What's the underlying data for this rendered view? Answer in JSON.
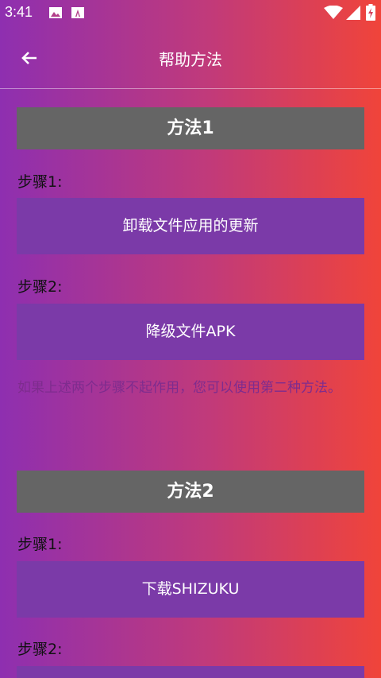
{
  "status_bar": {
    "time": "3:41"
  },
  "app_bar": {
    "title": "帮助方法"
  },
  "method1": {
    "title": "方法1",
    "step1_label": "步骤1:",
    "step1_button": "卸载文件应用的更新",
    "step2_label": "步骤2:",
    "step2_button": "降级文件APK",
    "note": "如果上述两个步骤不起作用，您可以使用第二种方法。"
  },
  "method2": {
    "title": "方法2",
    "step1_label": "步骤1:",
    "step1_button": "下载SHIZUKU",
    "step2_label": "步骤2:"
  },
  "colors": {
    "gradient_start": "#8e2fb0",
    "gradient_end": "#f0443a",
    "section_header_bg": "#656565",
    "action_button_bg": "#7b3aa8"
  },
  "icons": [
    "image-icon",
    "text-app-icon",
    "wifi-icon",
    "signal-icon",
    "battery-icon",
    "back-arrow-icon"
  ]
}
